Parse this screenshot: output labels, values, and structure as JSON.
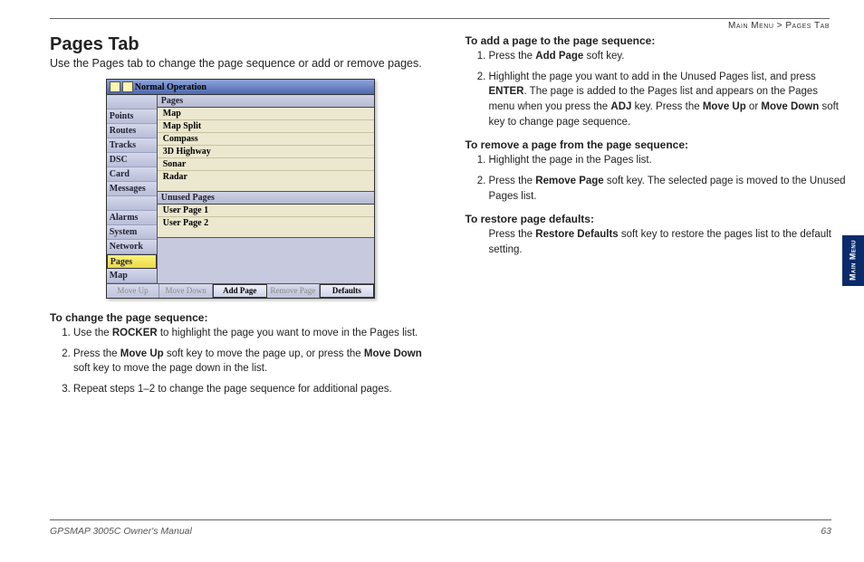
{
  "breadcrumb": {
    "section": "Main Menu",
    "page": "Pages Tab"
  },
  "left": {
    "title": "Pages Tab",
    "intro": "Use the Pages tab to change the page sequence or add or remove pages.",
    "change": {
      "heading": "To change the page sequence:",
      "step1_a": "Use the ",
      "step1_b": "ROCKER",
      "step1_c": " to highlight the page you want to move in the Pages list.",
      "step2_a": "Press the ",
      "step2_b": "Move Up",
      "step2_c": " soft key to move the page up, or press the ",
      "step2_d": "Move Down",
      "step2_e": " soft key to move the page down in the list.",
      "step3": "Repeat steps 1–2 to change the page sequence for additional pages."
    }
  },
  "right": {
    "add": {
      "heading": "To add a page to the page sequence:",
      "step1_a": "Press the ",
      "step1_b": "Add Page",
      "step1_c": " soft key.",
      "step2_a": "Highlight the page you want to add in the Unused Pages list, and press ",
      "step2_b": "ENTER",
      "step2_c": ". The page is added to the Pages list and appears on the Pages menu when you press the ",
      "step2_d": "ADJ",
      "step2_e": " key. Press the ",
      "step2_f": "Move Up",
      "step2_g": " or ",
      "step2_h": "Move Down",
      "step2_i": " soft key to change page sequence."
    },
    "remove": {
      "heading": "To remove a page from the page sequence:",
      "step1": "Highlight the page in the Pages list.",
      "step2_a": "Press the ",
      "step2_b": "Remove Page",
      "step2_c": " soft key. The selected page is moved to the Unused Pages list."
    },
    "restore": {
      "heading": "To restore page defaults:",
      "body_a": "Press the ",
      "body_b": "Restore Defaults",
      "body_c": " soft key to restore the pages list to the default setting."
    }
  },
  "screenshot": {
    "titlebar": "Normal Operation",
    "sidebar": [
      "",
      "Points",
      "Routes",
      "Tracks",
      "DSC",
      "Card",
      "Messages",
      "",
      "Alarms",
      "System",
      "Network",
      "Pages",
      "Map"
    ],
    "sidebar_selected_index": 11,
    "sidebar_dim_indexes": [
      0,
      7
    ],
    "pages_header": "Pages",
    "pages": [
      "Map",
      "Map Split",
      "Compass",
      "3D Highway",
      "Sonar",
      "Radar"
    ],
    "unused_header": "Unused Pages",
    "unused": [
      "User Page 1",
      "User Page 2"
    ],
    "softkeys": [
      {
        "label": "Move Up",
        "active": false
      },
      {
        "label": "Move Down",
        "active": false
      },
      {
        "label": "Add Page",
        "active": true
      },
      {
        "label": "Remove Page",
        "active": false
      },
      {
        "label": "Defaults",
        "active": true
      }
    ]
  },
  "edge_tab": "Main Menu",
  "footer": {
    "left": "GPSMAP 3005C Owner's Manual",
    "right": "63"
  }
}
